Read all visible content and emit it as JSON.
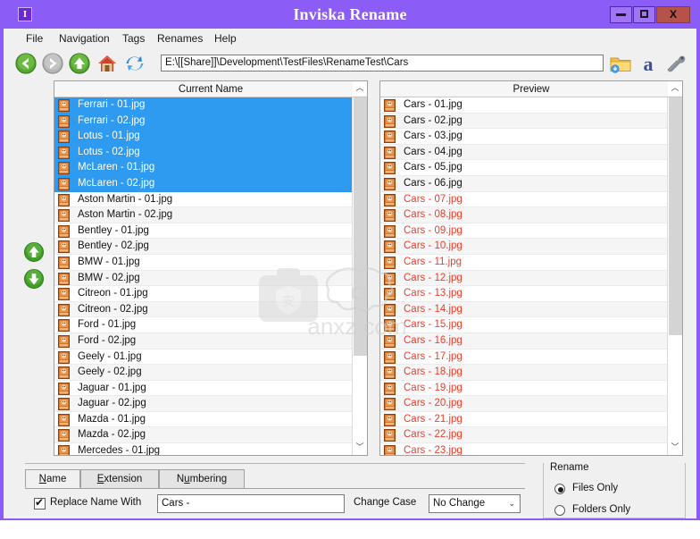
{
  "window": {
    "title": "Inviska Rename",
    "app_icon": "app-icon",
    "controls": {
      "minimize": "–",
      "maximize": "□",
      "close": "X"
    },
    "titlebar_color": "#8b5cf6"
  },
  "menubar": {
    "items": [
      "File",
      "Navigation",
      "Tags",
      "Renames",
      "Help"
    ]
  },
  "toolbar": {
    "back_icon": "back-arrow-icon",
    "forward_icon": "forward-arrow-icon",
    "up_icon": "up-arrow-icon",
    "home_icon": "home-icon",
    "refresh_icon": "refresh-icon",
    "path_value": "E:\\[[Share]]\\Development\\TestFiles\\RenameTest\\Cars",
    "path_placeholder": "Path",
    "open_folder_icon": "open-folder-icon",
    "font_icon": "font-a-icon",
    "tools_icon": "tools-icon"
  },
  "move_buttons": {
    "up_icon": "move-up-icon",
    "down_icon": "move-down-icon"
  },
  "lists": {
    "current": {
      "header": "Current Name",
      "rows": [
        {
          "name": "Ferrari - 01.jpg",
          "selected": true
        },
        {
          "name": "Ferrari - 02.jpg",
          "selected": true
        },
        {
          "name": "Lotus - 01.jpg",
          "selected": true
        },
        {
          "name": "Lotus - 02.jpg",
          "selected": true
        },
        {
          "name": "McLaren - 01.jpg",
          "selected": true
        },
        {
          "name": "McLaren - 02.jpg",
          "selected": true
        },
        {
          "name": "Aston Martin - 01.jpg",
          "selected": false
        },
        {
          "name": "Aston Martin - 02.jpg",
          "selected": false
        },
        {
          "name": "Bentley - 01.jpg",
          "selected": false
        },
        {
          "name": "Bentley - 02.jpg",
          "selected": false
        },
        {
          "name": "BMW - 01.jpg",
          "selected": false
        },
        {
          "name": "BMW - 02.jpg",
          "selected": false
        },
        {
          "name": "Citreon - 01.jpg",
          "selected": false
        },
        {
          "name": "Citreon - 02.jpg",
          "selected": false
        },
        {
          "name": "Ford - 01.jpg",
          "selected": false
        },
        {
          "name": "Ford - 02.jpg",
          "selected": false
        },
        {
          "name": "Geely - 01.jpg",
          "selected": false
        },
        {
          "name": "Geely - 02.jpg",
          "selected": false
        },
        {
          "name": "Jaguar - 01.jpg",
          "selected": false
        },
        {
          "name": "Jaguar - 02.jpg",
          "selected": false
        },
        {
          "name": "Mazda - 01.jpg",
          "selected": false
        },
        {
          "name": "Mazda - 02.jpg",
          "selected": false
        },
        {
          "name": "Mercedes - 01.jpg",
          "selected": false
        }
      ],
      "scroll_thumb_top_pct": 0,
      "scroll_thumb_height_pct": 78
    },
    "preview": {
      "header": "Preview",
      "rows": [
        {
          "name": "Cars - 01.jpg",
          "changed": false
        },
        {
          "name": "Cars - 02.jpg",
          "changed": false
        },
        {
          "name": "Cars - 03.jpg",
          "changed": false
        },
        {
          "name": "Cars - 04.jpg",
          "changed": false
        },
        {
          "name": "Cars - 05.jpg",
          "changed": false
        },
        {
          "name": "Cars - 06.jpg",
          "changed": false
        },
        {
          "name": "Cars - 07.jpg",
          "changed": true
        },
        {
          "name": "Cars - 08.jpg",
          "changed": true
        },
        {
          "name": "Cars - 09.jpg",
          "changed": true
        },
        {
          "name": "Cars - 10.jpg",
          "changed": true
        },
        {
          "name": "Cars - 11.jpg",
          "changed": true
        },
        {
          "name": "Cars - 12.jpg",
          "changed": true
        },
        {
          "name": "Cars - 13.jpg",
          "changed": true
        },
        {
          "name": "Cars - 14.jpg",
          "changed": true
        },
        {
          "name": "Cars - 15.jpg",
          "changed": true
        },
        {
          "name": "Cars - 16.jpg",
          "changed": true
        },
        {
          "name": "Cars - 17.jpg",
          "changed": true
        },
        {
          "name": "Cars - 18.jpg",
          "changed": true
        },
        {
          "name": "Cars - 19.jpg",
          "changed": true
        },
        {
          "name": "Cars - 20.jpg",
          "changed": true
        },
        {
          "name": "Cars - 21.jpg",
          "changed": true
        },
        {
          "name": "Cars - 22.jpg",
          "changed": true
        },
        {
          "name": "Cars - 23.jpg",
          "changed": true
        }
      ],
      "scroll_thumb_top_pct": 0,
      "scroll_thumb_height_pct": 72
    },
    "selected_text_color": "#ffffff",
    "selection_color": "#2e9bf0",
    "changed_text_color": "#f23c28"
  },
  "bottom_panel": {
    "tabs": [
      {
        "label": "Name",
        "mnemonic": "N",
        "active": true
      },
      {
        "label": "Extension",
        "mnemonic": "E",
        "active": false
      },
      {
        "label": "Numbering",
        "mnemonic": "u",
        "active": false
      }
    ],
    "replace_name_with": {
      "label": "Replace Name With",
      "checked": true,
      "value": "Cars - ",
      "placeholder": ""
    },
    "change_case": {
      "label": "Change Case",
      "value": "No Change",
      "caret": "⌄"
    }
  },
  "rename_group": {
    "legend": "Rename",
    "options": [
      {
        "label": "Files Only",
        "selected": true
      },
      {
        "label": "Folders Only",
        "selected": false
      }
    ]
  },
  "watermark": {
    "text": "anxz.com",
    "badge": "安"
  }
}
